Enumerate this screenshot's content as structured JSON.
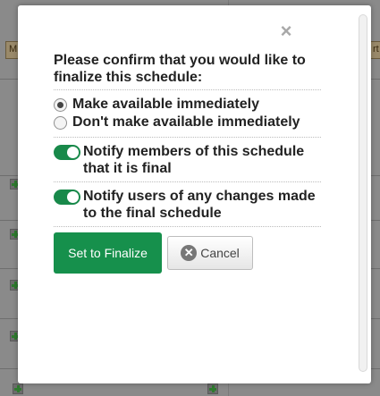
{
  "background": {
    "tab_left_label": "M",
    "tab_right_label": "rt"
  },
  "dialog": {
    "close_symbol": "×",
    "prompt": "Please confirm that you would like to finalize this schedule:",
    "availability_options": [
      {
        "label": "Make available immediately",
        "selected": true
      },
      {
        "label": "Don't make available immediately",
        "selected": false
      }
    ],
    "toggles": [
      {
        "label": "Notify members of this schedule that it is final",
        "on": true
      },
      {
        "label": "Notify users of any changes made to the final schedule",
        "on": true
      }
    ],
    "finalize_label": "Set to Finalize",
    "cancel_label": "Cancel",
    "cancel_icon_symbol": "✕"
  },
  "colors": {
    "accent": "#16904c",
    "overlay": "#8a8a8a"
  }
}
